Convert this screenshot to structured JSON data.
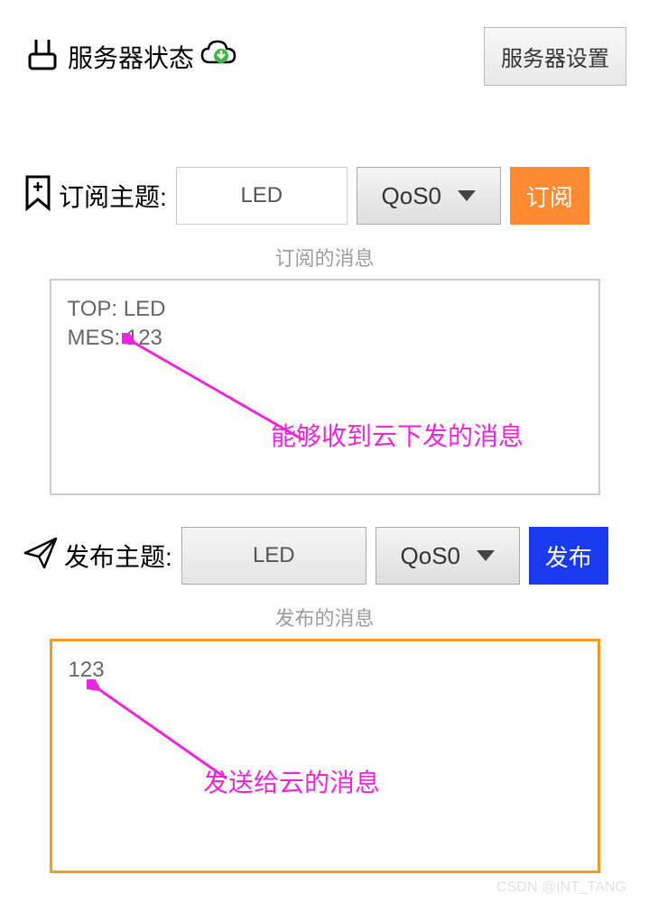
{
  "header": {
    "status_label": "服务器状态",
    "settings_label": "服务器设置"
  },
  "subscribe": {
    "label": "订阅主题:",
    "topic_value": "LED",
    "qos_label": "QoS0",
    "button_label": "订阅",
    "caption": "订阅的消息",
    "msg_line1": "TOP: LED",
    "msg_line2": "MES: 123"
  },
  "publish": {
    "label": "发布主题:",
    "topic_value": "LED",
    "qos_label": "QoS0",
    "button_label": "发布",
    "caption": "发布的消息",
    "msg_value": "123"
  },
  "annotations": {
    "receive": "能够收到云下发的消息",
    "send": "发送给云的消息"
  },
  "watermark": "CSDN @INT_TANG"
}
